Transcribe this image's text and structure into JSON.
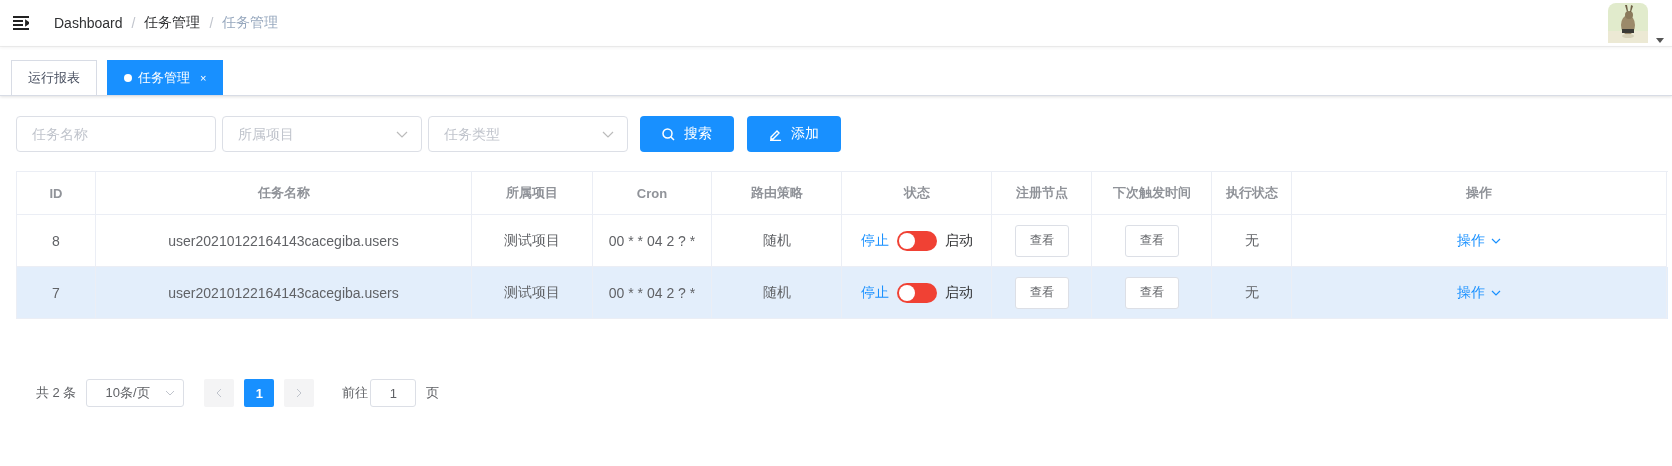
{
  "breadcrumb": [
    {
      "label": "Dashboard",
      "current": false
    },
    {
      "label": "任务管理",
      "current": false
    },
    {
      "label": "任务管理",
      "current": true
    }
  ],
  "breadcrumb_separator": "/",
  "tabs": [
    {
      "label": "运行报表",
      "selected": false
    },
    {
      "label": "任务管理",
      "selected": true,
      "close": "×"
    }
  ],
  "filters": [
    {
      "placeholder": "任务名称",
      "kind": "input"
    },
    {
      "placeholder": "所属项目",
      "kind": "select"
    },
    {
      "placeholder": "任务类型",
      "kind": "select"
    }
  ],
  "buttons": [
    {
      "label": "搜索",
      "kind": "search"
    },
    {
      "label": "添加",
      "kind": "add"
    }
  ],
  "table": {
    "columns": [
      "ID",
      "任务名称",
      "所属项目",
      "Cron",
      "路由策略",
      "状态",
      "注册节点",
      "下次触发时间",
      "执行状态",
      "操作"
    ],
    "rows": [
      {
        "id": "8",
        "name": "user20210122164143cacegiba.users",
        "project": "测试项目",
        "cron": "00 * * 04 2 ? *",
        "route": "随机",
        "off_label": "停止",
        "on": false,
        "on_label": "启动",
        "node": "查看",
        "next": "查看",
        "exec": "无",
        "action": "操作",
        "selected": false
      },
      {
        "id": "7",
        "name": "user20210122164143cacegiba.users",
        "project": "测试项目",
        "cron": "00 * * 04 2 ? *",
        "route": "随机",
        "off_label": "停止",
        "on": false,
        "on_label": "启动",
        "node": "查看",
        "next": "查看",
        "exec": "无",
        "action": "操作",
        "selected": true
      }
    ]
  },
  "pagination": {
    "total": "共 2 条",
    "page_size": "10条/页",
    "pages": [
      {
        "label": "1",
        "selected": true
      }
    ],
    "goto_label": "前往",
    "goto_value": "1",
    "goto_suffix": "页"
  }
}
